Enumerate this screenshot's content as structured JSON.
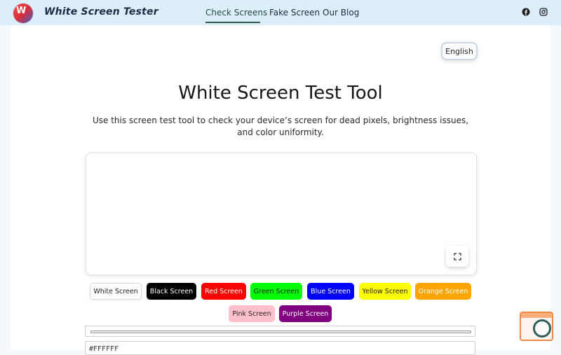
{
  "header": {
    "brand": "White Screen Tester",
    "nav": [
      {
        "label": "Check Screens",
        "active": true
      },
      {
        "label": "Fake Screen",
        "active": false
      },
      {
        "label": "Our Blog",
        "active": false
      }
    ],
    "social": [
      {
        "icon": "facebook-icon",
        "glyph": "f"
      },
      {
        "icon": "instagram-icon",
        "glyph": "◎"
      }
    ]
  },
  "language": {
    "label": "English"
  },
  "main": {
    "title": "White Screen Test Tool",
    "description": "Use this screen test tool to check your device’s screen for dead pixels, brightness issues, and color uniformity.",
    "fullscreen_icon": "⛶"
  },
  "screens": [
    {
      "label": "White Screen",
      "bg": "#FFFFFF",
      "fg": "#222222"
    },
    {
      "label": "Black Screen",
      "bg": "#000000",
      "fg": "#FFFFFF"
    },
    {
      "label": "Red Screen",
      "bg": "#FF0000",
      "fg": "#FFFFFF"
    },
    {
      "label": "Green Screen",
      "bg": "#00FF00",
      "fg": "#222222"
    },
    {
      "label": "Blue Screen",
      "bg": "#0000FF",
      "fg": "#FFFFFF"
    },
    {
      "label": "Yellow Screen",
      "bg": "#FFFF00",
      "fg": "#222222"
    },
    {
      "label": "Orange Screen",
      "bg": "#FFA500",
      "fg": "#FFFFFF"
    },
    {
      "label": "Pink Screen",
      "bg": "#FFC0CB",
      "fg": "#222222"
    },
    {
      "label": "Purple Screen",
      "bg": "#800080",
      "fg": "#FFFFFF"
    }
  ],
  "color_input": {
    "value": "#FFFFFF"
  },
  "colors": {
    "header_bg": "#DBEEFA",
    "nav_active": "#2D5A45"
  }
}
